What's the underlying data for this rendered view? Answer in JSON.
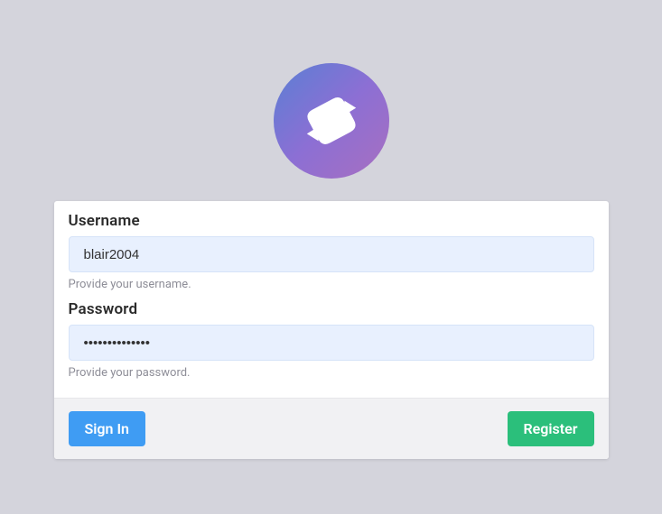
{
  "form": {
    "username": {
      "label": "Username",
      "value": "blair2004",
      "help": "Provide your username."
    },
    "password": {
      "label": "Password",
      "value": "••••••••••••••",
      "help": "Provide your password."
    }
  },
  "buttons": {
    "signin": "Sign In",
    "register": "Register"
  }
}
